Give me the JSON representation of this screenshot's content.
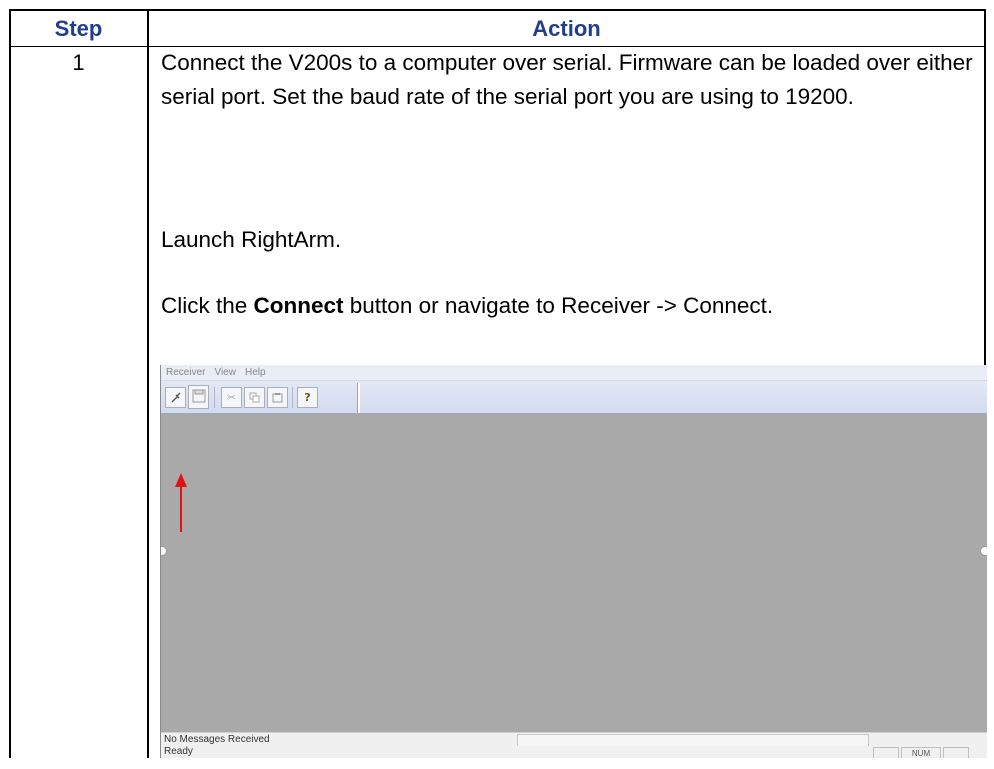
{
  "table": {
    "headers": {
      "step": "Step",
      "action": "Action"
    },
    "rows": [
      {
        "step": "1",
        "para1": "Connect the V200s to a computer over serial. Firmware can be loaded over either serial port. Set the baud rate of the serial port you are using to 19200.",
        "para2": "Launch RightArm.",
        "para3_before": "Click the ",
        "para3_bold": "Connect",
        "para3_after": " button or navigate to Receiver -> Connect."
      }
    ]
  },
  "app_screenshot": {
    "menu": [
      "Receiver",
      "View",
      "Help"
    ],
    "toolbar_icons": [
      "connect-icon",
      "save-icon",
      "cut-icon",
      "copy-icon",
      "paste-icon",
      "help-icon"
    ],
    "status_message": "No Messages Received",
    "status_ready": "Ready",
    "indicator_num": "NUM",
    "arrow_color": "#e01414",
    "workspace_color": "#a9a9a9"
  },
  "colors": {
    "header_text": "#1f3e8c"
  }
}
